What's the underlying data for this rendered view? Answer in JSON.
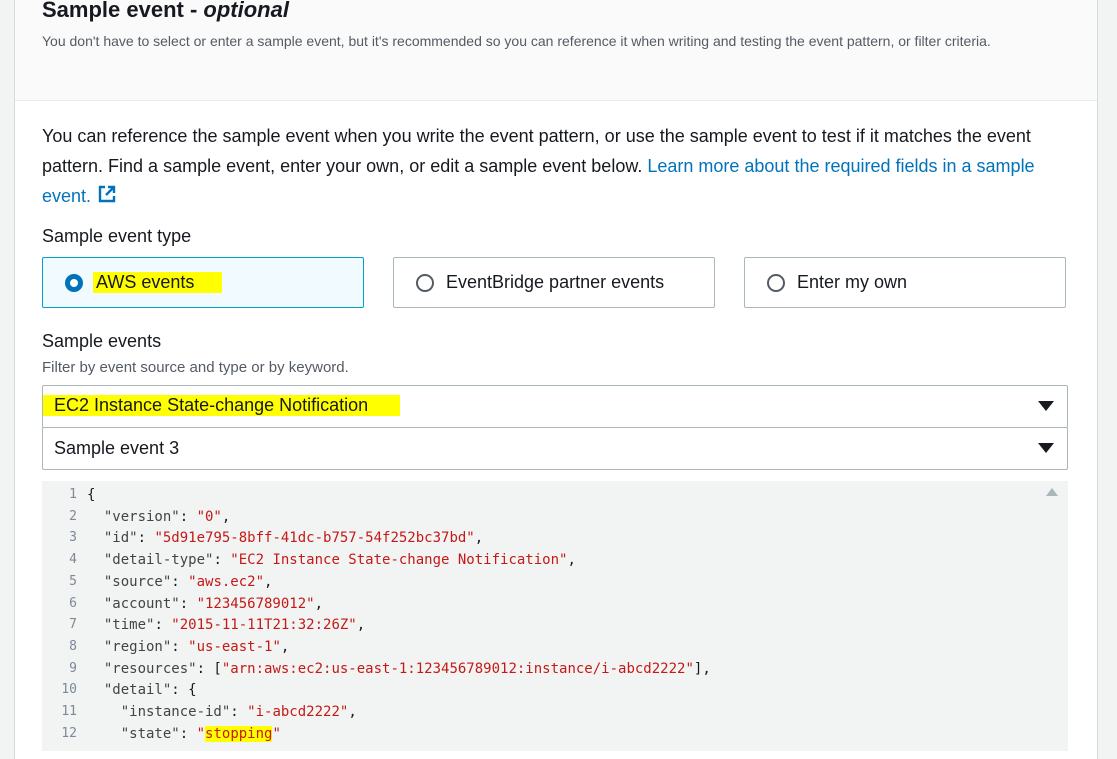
{
  "header": {
    "title": "Sample event -",
    "title_optional": "optional",
    "description": "You don't have to select or enter a sample event, but it's recommended so you can reference it when writing and testing the event pattern, or filter criteria."
  },
  "intro": {
    "text": "You can reference the sample event when you write the event pattern, or use the sample event to test if it matches the event pattern. Find a sample event, enter your own, or edit a sample event below. ",
    "link_text": "Learn more about the required fields in a sample event.",
    "link_icon": "external-link-icon"
  },
  "event_type": {
    "label": "Sample event type",
    "options": [
      {
        "label": "AWS events",
        "selected": true
      },
      {
        "label": "EventBridge partner events",
        "selected": false
      },
      {
        "label": "Enter my own",
        "selected": false
      }
    ]
  },
  "sample_events": {
    "label": "Sample events",
    "description": "Filter by event source and type or by keyword.",
    "source_select": "EC2 Instance State-change Notification",
    "event_select": "Sample event 3"
  },
  "editor": {
    "lines": [
      "{",
      "  \"version\": \"0\",",
      "  \"id\": \"5d91e795-8bff-41dc-b757-54f252bc37bd\",",
      "  \"detail-type\": \"EC2 Instance State-change Notification\",",
      "  \"source\": \"aws.ec2\",",
      "  \"account\": \"123456789012\",",
      "  \"time\": \"2015-11-11T21:32:26Z\",",
      "  \"region\": \"us-east-1\",",
      "  \"resources\": [\"arn:aws:ec2:us-east-1:123456789012:instance/i-abcd2222\"],",
      "  \"detail\": {",
      "    \"instance-id\": \"i-abcd2222\",",
      "    \"state\": \"stopping\""
    ],
    "line_numbers": [
      "1",
      "2",
      "3",
      "4",
      "5",
      "6",
      "7",
      "8",
      "9",
      "10",
      "11",
      "12"
    ]
  },
  "colors": {
    "link": "#0073bb",
    "highlight": "#ffff00",
    "selected_tile_bg": "#f1faff",
    "string": "#c41a16"
  }
}
